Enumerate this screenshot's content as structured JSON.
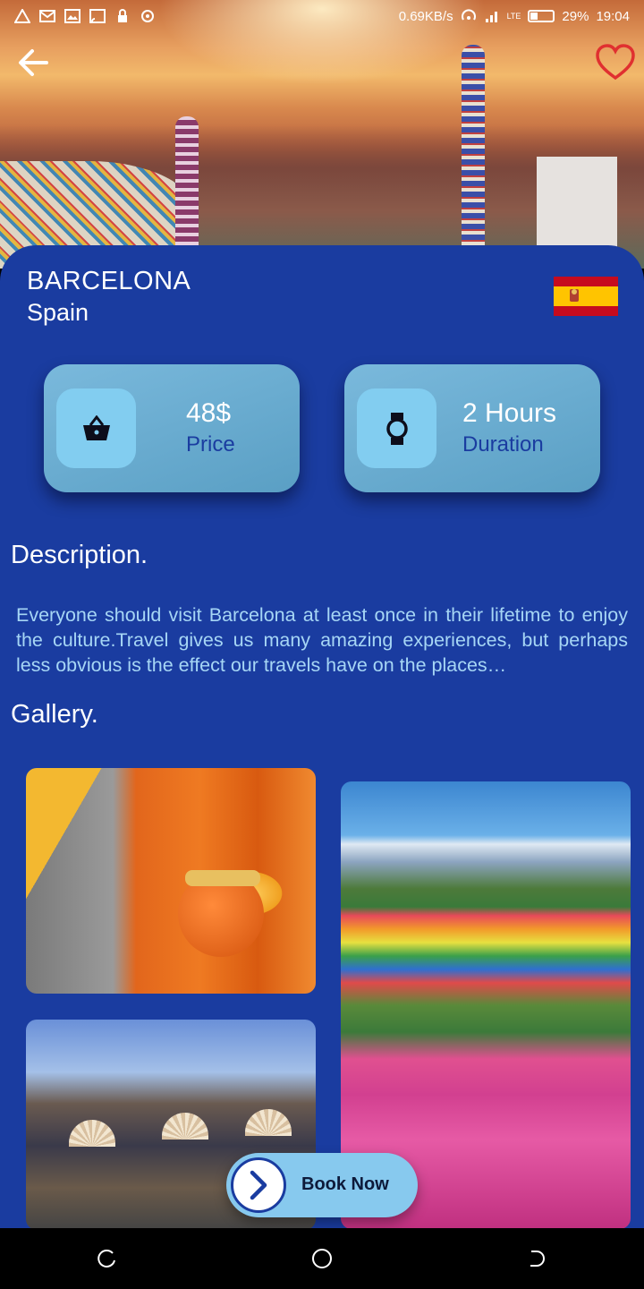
{
  "status_bar": {
    "network_speed": "0.69KB/s",
    "network_type": "LTE",
    "battery": "29%",
    "time": "19:04",
    "icons": [
      "alert-icon",
      "mail-icon",
      "gallery-icon",
      "cast-icon",
      "lock-icon",
      "sync-icon",
      "hotspot-icon",
      "signal-icon",
      "battery-icon"
    ]
  },
  "header": {
    "back_icon": "arrow-left-icon",
    "favorite_icon": "heart-outline-icon"
  },
  "destination": {
    "city": "BARCELONA",
    "country": "Spain",
    "flag": "spain-flag"
  },
  "info_cards": [
    {
      "icon": "basket-icon",
      "value": "48$",
      "label": "Price"
    },
    {
      "icon": "watch-icon",
      "value": "2 Hours",
      "label": "Duration"
    }
  ],
  "description": {
    "title": "Description.",
    "text": "Everyone should visit Barcelona at least once in their lifetime to enjoy the culture.Travel gives us many amazing experiences, but perhaps less obvious is the effect our travels have on the places…"
  },
  "gallery": {
    "title": "Gallery.",
    "images": [
      "monk-photo",
      "flower-fields-photo",
      "street-market-photo"
    ]
  },
  "book_button": {
    "label": "Book Now",
    "icon": "chevron-right-icon"
  },
  "nav_bar": {
    "icons": [
      "recent-apps-icon",
      "home-icon",
      "back-icon"
    ]
  },
  "colors": {
    "panel": "#1a3ca0",
    "card": "#6aabd0",
    "card_icon_box": "#82cdf0",
    "label_accent": "#1a3ca0",
    "description_text": "#a6d6f5",
    "favorite": "#e03030"
  }
}
